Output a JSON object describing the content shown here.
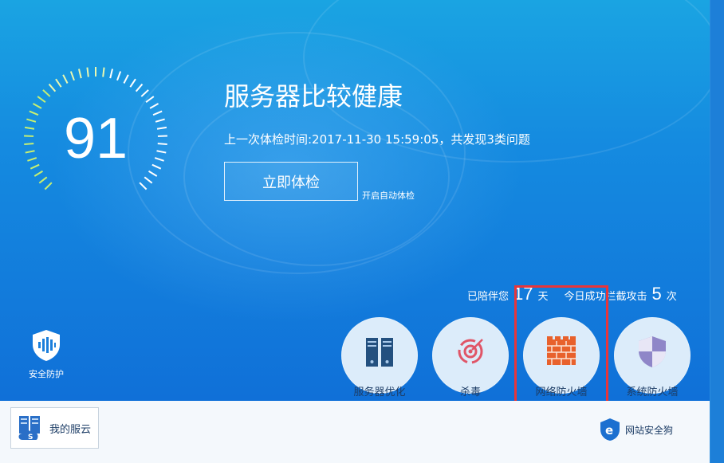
{
  "score": "91",
  "status_title": "服务器比较健康",
  "last_check": "上一次体检时间:2017-11-30 15:59:05，共发现3类问题",
  "check_button": "立即体检",
  "auto_check": "开启自动体检",
  "stats": {
    "prefix": "已陪伴您",
    "days": "17",
    "days_unit": "天",
    "middle": "今日成功拦截攻击",
    "attacks": "5",
    "attacks_unit": "次"
  },
  "left_shield": {
    "label": "安全防护"
  },
  "features": [
    {
      "label": "服务器优化",
      "icon": "server-icon"
    },
    {
      "label": "杀毒",
      "icon": "virus-target-icon"
    },
    {
      "label": "网络防火墙",
      "icon": "firewall-brick-icon"
    },
    {
      "label": "系统防火墙",
      "icon": "shield-icon"
    }
  ],
  "bottom": {
    "cloud_button": "我的服云",
    "website_dog": "网站安全狗"
  },
  "colors": {
    "accent_red": "#e8353a",
    "brick": "#e8612c",
    "bg_blue": "#1070d8"
  }
}
